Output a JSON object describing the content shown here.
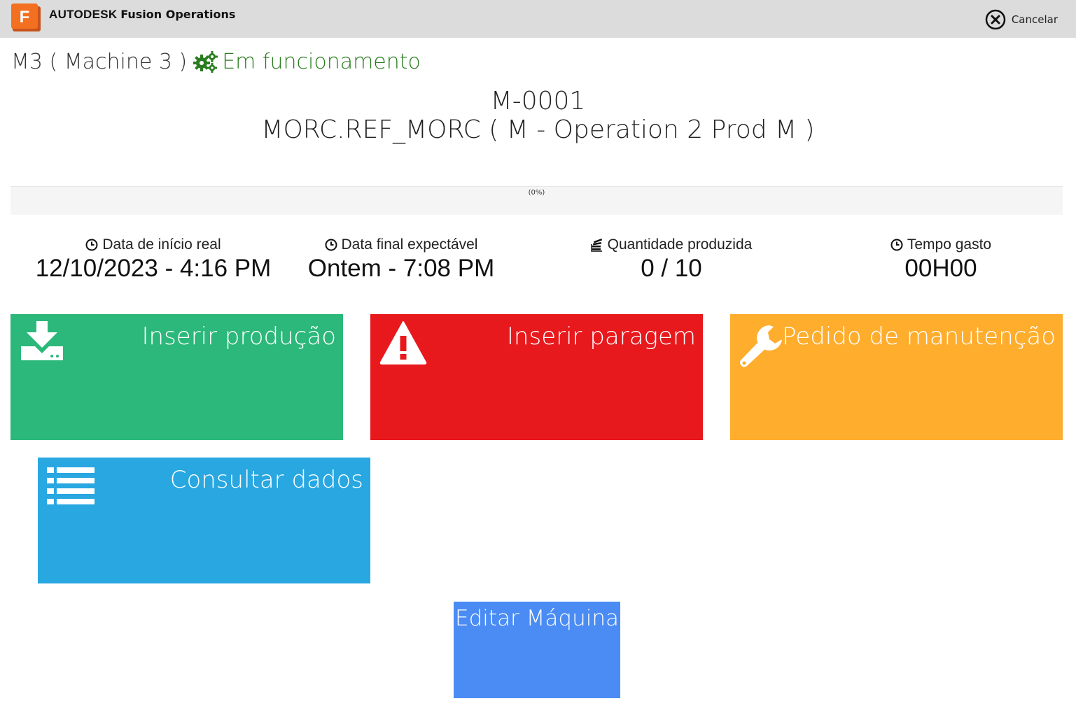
{
  "header": {
    "logo_letter": "F",
    "brand_company": "AUTODESK",
    "brand_product": "Fusion Operations",
    "cancel_label": "Cancelar",
    "cancel_icon": "close-circle-icon"
  },
  "machine": {
    "name": "M3 ( Machine 3 )",
    "status": "Em funcionamento",
    "status_icon": "gears-icon",
    "status_color": "#2a7d1f"
  },
  "order": {
    "code": "M-0001",
    "description": "MORC.REF_MORC  ( M - Operation 2 Prod M )"
  },
  "progress": {
    "label": "(0%)",
    "value": 0
  },
  "stats": [
    {
      "label": "Data de início real",
      "value": "12/10/2023 - 4:16 PM",
      "icon": "clock-icon"
    },
    {
      "label": "Data final expectável",
      "value": "Ontem - 7:08 PM",
      "icon": "clock-icon"
    },
    {
      "label": "Quantidade produzida",
      "value": "0 / 10",
      "icon": "stack-icon"
    },
    {
      "label": "Tempo gasto",
      "value": "00H00",
      "icon": "clock-icon"
    }
  ],
  "tiles": [
    {
      "label": "Inserir produção",
      "icon": "download-icon",
      "color": "#2bb87a"
    },
    {
      "label": "Inserir paragem",
      "icon": "warning-icon",
      "color": "#e8191d"
    },
    {
      "label": "Pedido de manutenção",
      "icon": "wrench-icon",
      "color": "#ffad2d"
    },
    {
      "label": "Consultar dados",
      "icon": "list-icon",
      "color": "#28a7e1"
    },
    {
      "label": "Editar Máquina",
      "color": "#4a8cf4"
    }
  ]
}
